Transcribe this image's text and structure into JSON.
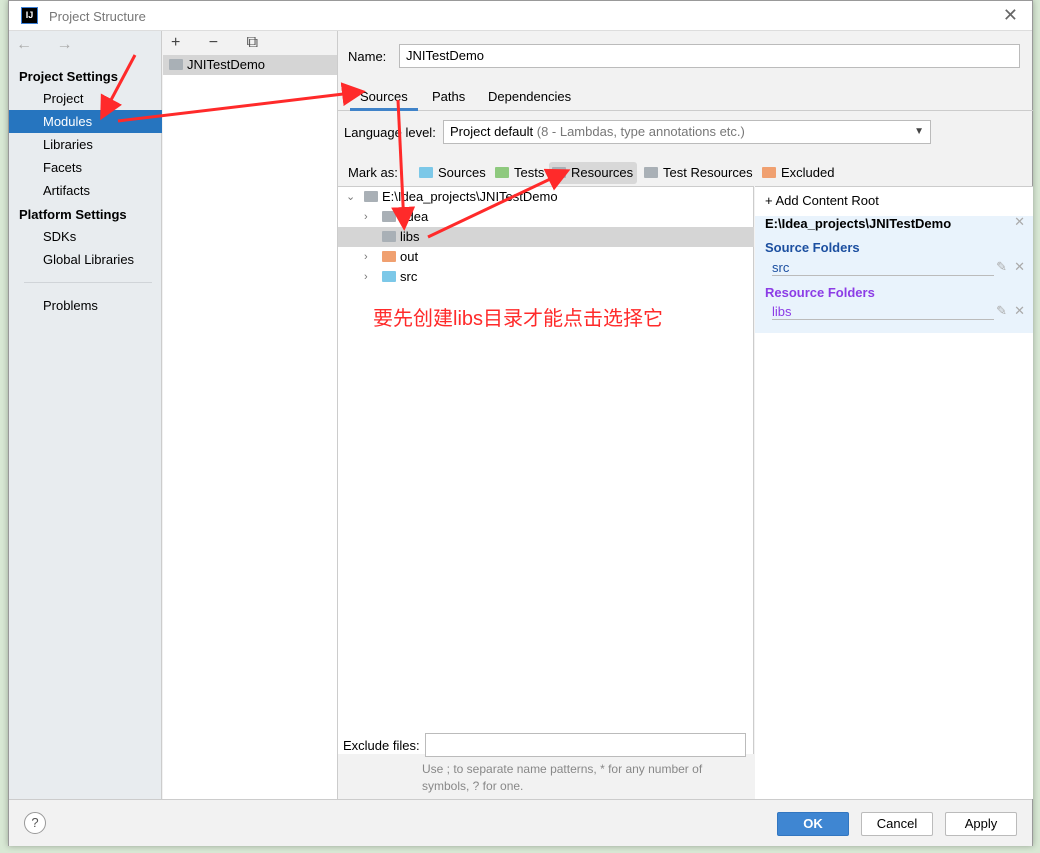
{
  "window": {
    "title": "Project Structure",
    "close": "✕",
    "logo": "IJ"
  },
  "sidebar": {
    "nav": "← →",
    "project_settings": "Project Settings",
    "platform_settings": "Platform Settings",
    "items": [
      "Project",
      "Modules",
      "Libraries",
      "Facets",
      "Artifacts"
    ],
    "platform_items": [
      "SDKs",
      "Global Libraries"
    ],
    "problems": "Problems",
    "selected": "Modules"
  },
  "modules": {
    "toolbar": "+ − ⧉",
    "items": [
      "JNITestDemo"
    ]
  },
  "module": {
    "name_label": "Name:",
    "name_value": "JNITestDemo",
    "tabs": [
      "Sources",
      "Paths",
      "Dependencies"
    ],
    "active_tab": "Sources",
    "language_label": "Language level:",
    "language_value": "Project default",
    "language_hint": "(8 - Lambdas, type annotations etc.)",
    "mark_as_label": "Mark as:",
    "mark_as": [
      {
        "label": "Sources",
        "color": "#7cc8e8"
      },
      {
        "label": "Tests",
        "color": "#8ec97e"
      },
      {
        "label": "Resources",
        "color": "#a9b0b6"
      },
      {
        "label": "Test Resources",
        "color": "#a9b0b6"
      },
      {
        "label": "Excluded",
        "color": "#f0a070"
      }
    ],
    "tree": {
      "root": "E:\\Idea_projects\\JNITestDemo",
      "children": [
        {
          "name": ".idea",
          "color": "#a9b0b6"
        },
        {
          "name": "libs",
          "color": "#a9b0b6",
          "selected": true
        },
        {
          "name": "out",
          "color": "#f0a070"
        },
        {
          "name": "src",
          "color": "#7cc8e8"
        }
      ]
    },
    "exclude_label": "Exclude files:",
    "exclude_value": "",
    "exclude_hint1": "Use ; to separate name patterns, * for any number of",
    "exclude_hint2": "symbols, ? for one."
  },
  "content_root": {
    "add": "+ Add Content Root",
    "path": "E:\\Idea_projects\\JNITestDemo",
    "source_title": "Source Folders",
    "source_items": [
      "src"
    ],
    "resource_title": "Resource Folders",
    "resource_items": [
      "libs"
    ],
    "source_color": "#1c4fa0",
    "resource_color": "#8c3ce6"
  },
  "annotation": {
    "text": "要先创建libs目录才能点击选择它",
    "color": "#ff2a2a"
  },
  "buttons": {
    "help": "?",
    "ok": "OK",
    "cancel": "Cancel",
    "apply": "Apply"
  }
}
